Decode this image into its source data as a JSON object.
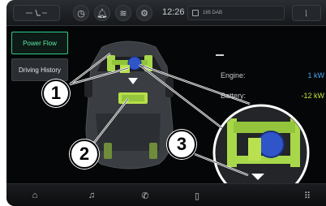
{
  "statusbar": {
    "clock": "12:26",
    "radio_station": "165 DAB",
    "icons": [
      "seat-climate-icon",
      "bell-icon",
      "wifi-icon",
      "settings-location-icon"
    ]
  },
  "tabs": [
    {
      "label": "Power Flow",
      "active": true
    },
    {
      "label": "Driving History",
      "active": false
    }
  ],
  "power_flow": {
    "engine_label": "Engine:",
    "engine_value": "1 kW",
    "battery_label": "Battery:",
    "battery_value": "-12 kW"
  },
  "callouts": [
    "1",
    "2",
    "3"
  ],
  "bottom_nav": [
    "home-icon",
    "music-icon",
    "phone-icon",
    "device-icon",
    "apps-icon"
  ],
  "colors": {
    "accent_green": "#2ec98a",
    "engine_blue": "#4aa3f0",
    "battery_yellow_green": "#c9e33c",
    "drivetrain_green": "#a8d84a",
    "motor_blue": "#2f55c9"
  }
}
